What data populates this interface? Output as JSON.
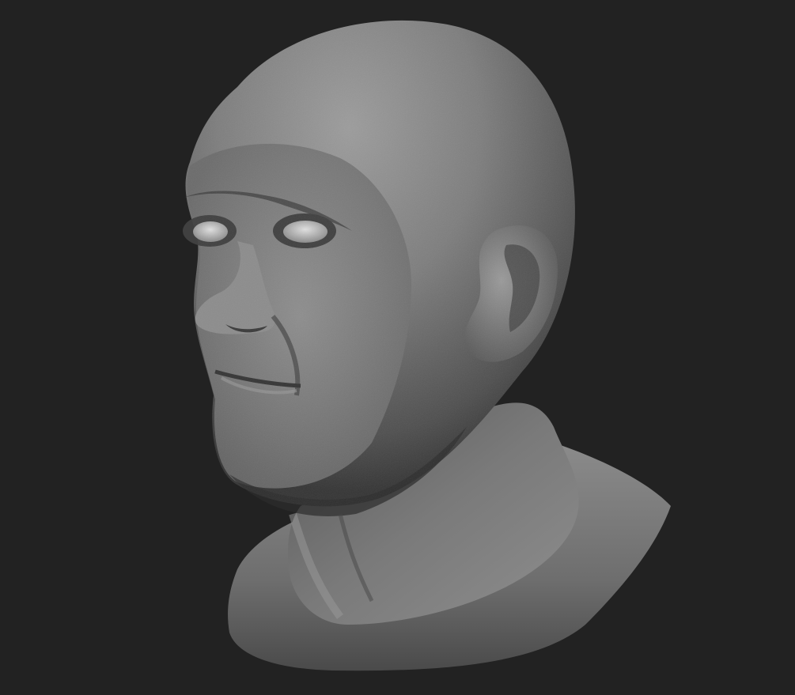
{
  "scene": {
    "background_color": "#222222",
    "material_base_color": "#8a8a8a",
    "material_shadow_color": "#3a3a3a",
    "material_highlight_color": "#c4c4c4",
    "subject": "bust-sculpt"
  }
}
